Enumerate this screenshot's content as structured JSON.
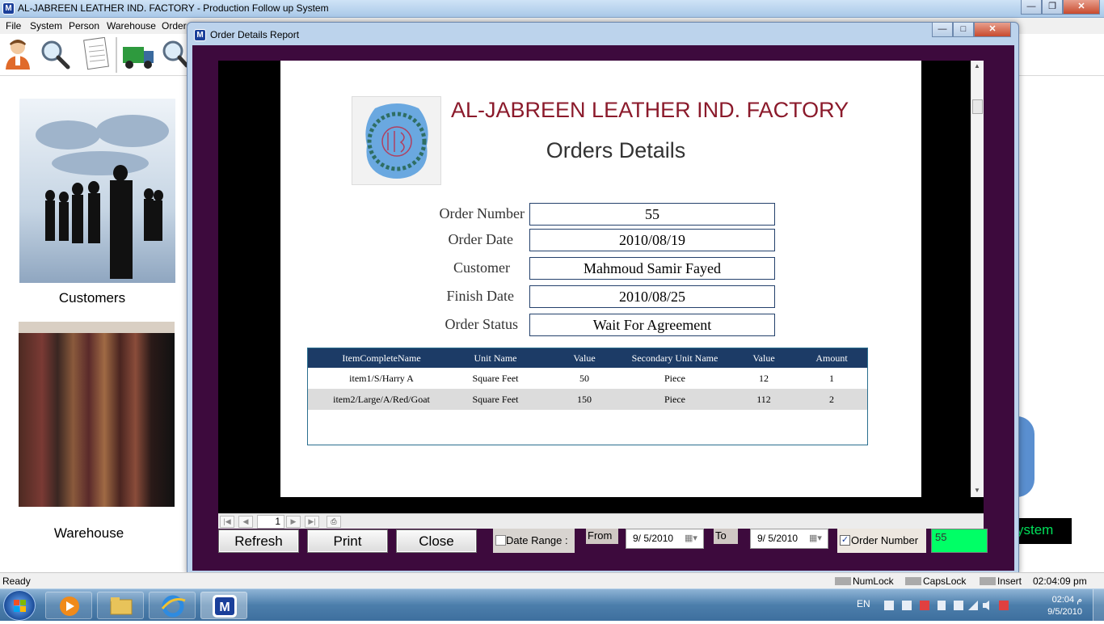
{
  "main_window": {
    "title": "AL-JABREEN LEATHER IND. FACTORY - Production Follow up System",
    "app_icon_letter": "M"
  },
  "menu": [
    "File",
    "System",
    "Person",
    "Warehouse",
    "Orders"
  ],
  "left_panel": {
    "customers_label": "Customers",
    "warehouse_label": "Warehouse"
  },
  "behind_dialog_label": "ystem",
  "dialog": {
    "title": "Order Details Report",
    "report": {
      "company": "AL-JABREEN LEATHER IND. FACTORY",
      "heading": "Orders Details",
      "fields": [
        {
          "label": "Order Number",
          "value": "55"
        },
        {
          "label": "Order Date",
          "value": "2010/08/19"
        },
        {
          "label": "Customer",
          "value": "Mahmoud Samir Fayed"
        },
        {
          "label": "Finish Date",
          "value": "2010/08/25"
        },
        {
          "label": "Order Status",
          "value": "Wait For Agreement"
        }
      ],
      "table": {
        "columns": [
          "ItemCompleteName",
          "Unit Name",
          "Value",
          "Secondary Unit Name",
          "Value",
          "Amount"
        ],
        "rows": [
          [
            "item1/S/Harry A",
            "Square Feet",
            "50",
            "Piece",
            "12",
            "1"
          ],
          [
            "item2/Large/A/Red/Goat",
            "Square Feet",
            "150",
            "Piece",
            "112",
            "2"
          ]
        ]
      }
    },
    "page_number": "1",
    "buttons": {
      "refresh": "Refresh",
      "print": "Print",
      "close": "Close"
    },
    "date_range_label": "Date Range :",
    "from_label": "From",
    "from_date": "9/ 5/2010",
    "to_label": "To",
    "to_date": "9/ 5/2010",
    "order_number_label": "Order Number",
    "order_number_value": "55",
    "order_number_checked": true,
    "date_range_checked": false
  },
  "status": {
    "left": "Ready",
    "numlock": "NumLock",
    "capslock": "CapsLock",
    "insert": "Insert",
    "time": "02:04:09 pm"
  },
  "taskbar": {
    "lang": "EN",
    "time": "02:04 م",
    "date": "9/5/2010"
  },
  "colors": {
    "dialog_body": "#3d0a3d",
    "report_company": "#8b1a2b",
    "table_header": "#1c3b66",
    "order_number_field": "#00ff66"
  }
}
